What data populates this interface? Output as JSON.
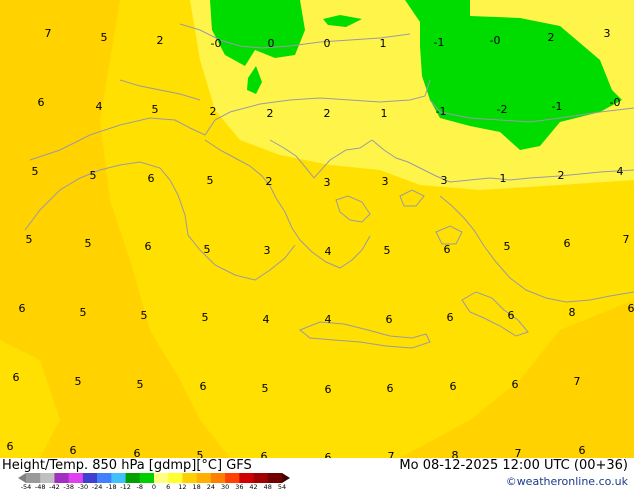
{
  "footer": {
    "title": "Height/Temp. 850 hPa [gdmp][°C] GFS",
    "datetime": "Mo 08-12-2025 12:00 UTC (00+36)",
    "credit": "©weatheronline.co.uk"
  },
  "legend": {
    "ticks": [
      "-54",
      "-48",
      "-42",
      "-38",
      "-30",
      "-24",
      "-18",
      "-12",
      "-8",
      "0",
      "6",
      "12",
      "18",
      "24",
      "30",
      "36",
      "42",
      "48",
      "54"
    ],
    "colors": [
      "#9a9a9a",
      "#c0c0c0",
      "#a030c0",
      "#e040f0",
      "#4040d0",
      "#4080ff",
      "#40c0ff",
      "#00a000",
      "#00d000",
      "#ffff80",
      "#ffff30",
      "#ffd000",
      "#ffb000",
      "#ff8000",
      "#ff4000",
      "#d00000",
      "#a00000",
      "#700000"
    ]
  },
  "map": {
    "colors": {
      "warm": "#ffd200",
      "mid": "#ffe000",
      "cool": "#fff54a",
      "cold": "#00dc00",
      "coast": "#9a9aa6"
    },
    "temperature_labels": [
      "7",
      "5",
      "2",
      "-0",
      "0",
      "0",
      "1",
      "-1",
      "-0",
      "2",
      "3",
      "6",
      "4",
      "5",
      "2",
      "2",
      "2",
      "1",
      "-1",
      "-2",
      "-1",
      "-0",
      "5",
      "5",
      "6",
      "5",
      "2",
      "3",
      "3",
      "3",
      "1",
      "2",
      "4",
      "5",
      "5",
      "6",
      "5",
      "3",
      "4",
      "5",
      "6",
      "5",
      "6",
      "7",
      "6",
      "5",
      "5",
      "5",
      "4",
      "4",
      "6",
      "6",
      "6",
      "8",
      "6",
      "6",
      "5",
      "5",
      "6",
      "5",
      "6",
      "6",
      "6",
      "6",
      "7",
      "6",
      "6",
      "6",
      "5",
      "6",
      "6",
      "7",
      "8",
      "7",
      "6"
    ]
  }
}
